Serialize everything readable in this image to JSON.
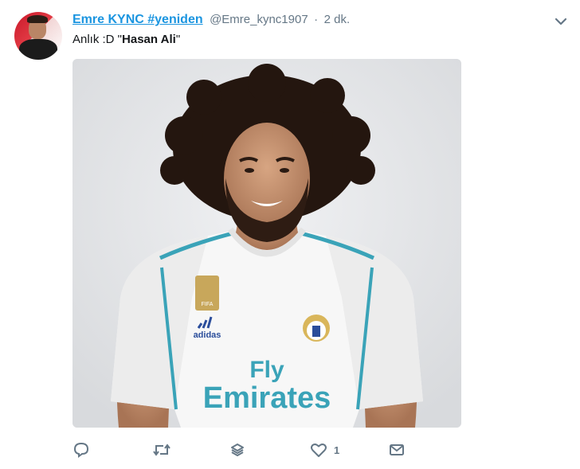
{
  "tweet": {
    "author": {
      "display_name": "Emre KYNC #yeniden",
      "handle": "@Emre_kync1907"
    },
    "separator": "·",
    "time": "2 dk.",
    "text": {
      "prefix": "Anlık :D \"",
      "bold": "Hasan Ali",
      "suffix": "\""
    },
    "image": {
      "jersey_sponsor_line1": "Fly",
      "jersey_sponsor_line2": "Emirates",
      "jersey_brand": "adidas",
      "badge_text": "FIFA"
    },
    "actions": {
      "reply_icon": "reply-icon",
      "retweet_icon": "retweet-icon",
      "stack_icon": "layers-icon",
      "like_icon": "heart-icon",
      "like_count": "1",
      "dm_icon": "mail-icon"
    },
    "menu_icon": "chevron-down-icon"
  },
  "colors": {
    "link_blue": "#1b95e0",
    "muted_gray": "#657786",
    "jersey_teal": "#3aa3b8"
  }
}
